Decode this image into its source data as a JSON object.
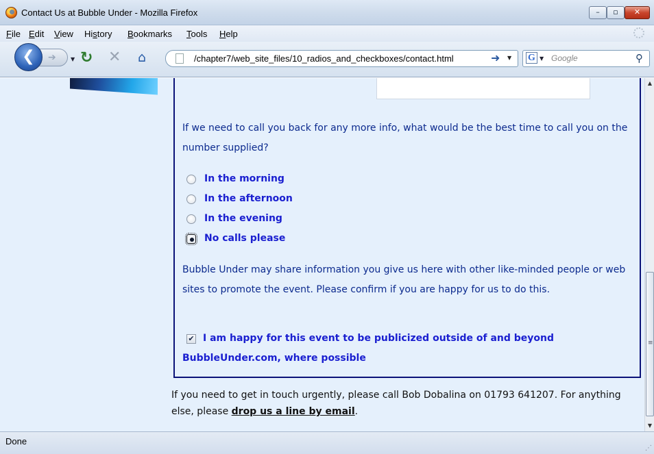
{
  "window": {
    "title": "Contact Us at Bubble Under - Mozilla Firefox",
    "minimize": "–",
    "maximize": "▫",
    "close": "✕"
  },
  "menu": [
    {
      "label": "File",
      "u": "F",
      "rest": "ile"
    },
    {
      "label": "Edit",
      "u": "E",
      "rest": "dit"
    },
    {
      "label": "View",
      "u": "V",
      "rest": "iew"
    },
    {
      "label": "History",
      "pre": "Hi",
      "u": "s",
      "rest": "tory"
    },
    {
      "label": "Bookmarks",
      "u": "B",
      "rest": "ookmarks"
    },
    {
      "label": "Tools",
      "u": "T",
      "rest": "ools"
    },
    {
      "label": "Help",
      "u": "H",
      "rest": "elp"
    }
  ],
  "toolbar": {
    "url": "/chapter7/web_site_files/10_radios_and_checkboxes/contact.html",
    "search_placeholder": "Google"
  },
  "form": {
    "callback_question": "If we need to call you back for any more info, what would be the best time to call you on the number supplied?",
    "radios": [
      {
        "label": "In the morning",
        "checked": false
      },
      {
        "label": "In the afternoon",
        "checked": false
      },
      {
        "label": "In the evening",
        "checked": false
      },
      {
        "label": "No calls please",
        "checked": true
      }
    ],
    "share_notice": "Bubble Under may share information you give us here with other like-minded people or web sites to promote the event. Please confirm if you are happy for us to do this.",
    "publicize_label": "I am happy for this event to be publicized outside of and beyond BubbleUnder.com, where possible",
    "publicize_checked": true
  },
  "footer": {
    "before_link": "If you need to get in touch urgently, please call Bob Dobalina on 01793 641207. For anything else, please ",
    "link": "drop us a line by email",
    "after_link": "."
  },
  "status": {
    "text": "Done"
  },
  "colors": {
    "label_blue": "#1a1fd0",
    "text_blue": "#0c2a8e",
    "fieldset_border": "#0a1178",
    "page_bg": "#e5f0fc"
  }
}
